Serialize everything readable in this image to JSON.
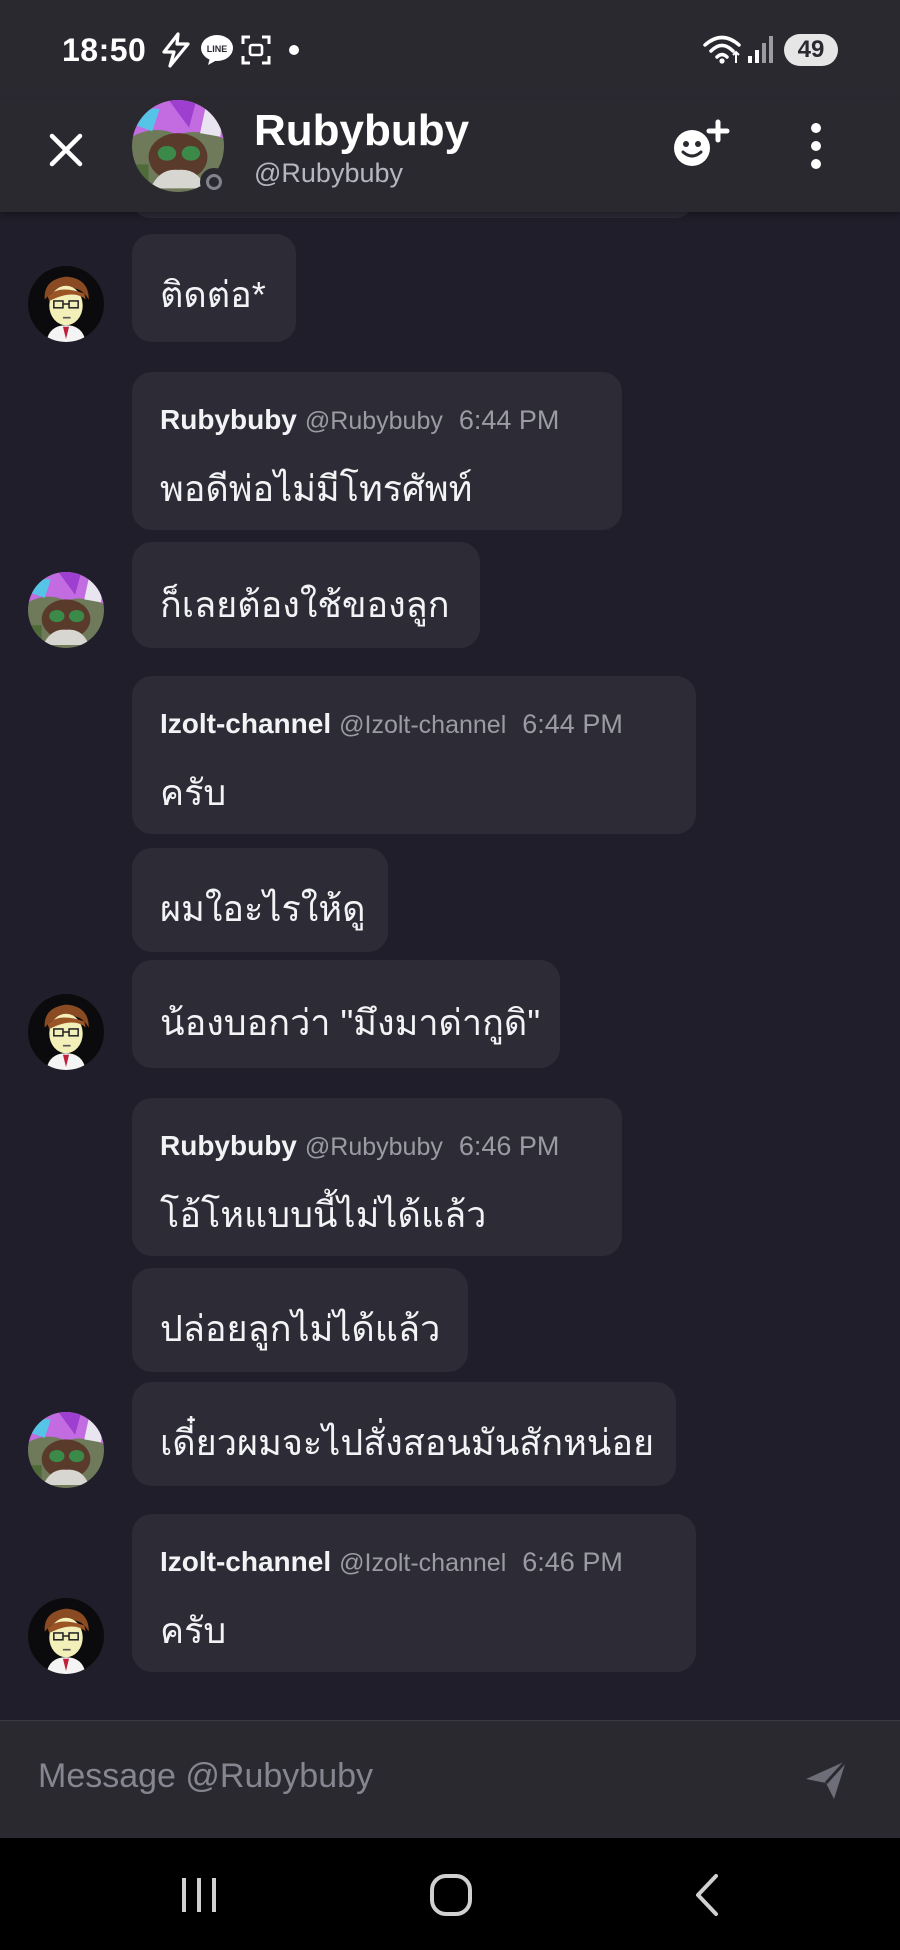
{
  "status_bar": {
    "time": "18:50",
    "battery": "49",
    "icons": [
      "bolt-icon",
      "line-app-icon",
      "screenshot-icon",
      "dot-icon",
      "wifi-icon",
      "signal-icon"
    ]
  },
  "header": {
    "name": "Rubybuby",
    "handle": "@Rubybuby",
    "presence": "offline",
    "icons": [
      "close-icon",
      "add-friend-icon",
      "more-icon"
    ]
  },
  "messages": [
    {
      "text": "ติดต่อ*"
    },
    {
      "author": "Rubybuby",
      "handle": "@Rubybuby",
      "time": "6:44 PM",
      "text": "พอดีพ่อไม่มีโทรศัพท์"
    },
    {
      "text": "ก็เลยต้องใช้ของลูก"
    },
    {
      "author": "Izolt-channel",
      "handle": "@Izolt-channel",
      "time": "6:44 PM",
      "text": "ครับ"
    },
    {
      "text": "ผมใอะไรให้ดู"
    },
    {
      "text": "น้องบอกว่า \"มึงมาด่ากูดิ\""
    },
    {
      "author": "Rubybuby",
      "handle": "@Rubybuby",
      "time": "6:46 PM",
      "text": "โอ้โหแบบนี้ไม่ได้แล้ว"
    },
    {
      "text": "ปล่อยลูกไม่ได้แล้ว"
    },
    {
      "text": "เดี๋ยวผมจะไปสั่งสอนมันสักหน่อย"
    },
    {
      "author": "Izolt-channel",
      "handle": "@Izolt-channel",
      "time": "6:46 PM",
      "text": "ครับ"
    }
  ],
  "composer": {
    "placeholder": "Message @Rubybuby",
    "send_icon": "send-icon"
  },
  "nav_bar": {
    "icons": [
      "recents-icon",
      "home-icon",
      "back-icon"
    ]
  },
  "colors": {
    "background": "#201e2a",
    "header": "#2a2930",
    "bubble": "#2d2c36",
    "text": "#f2f3f5",
    "muted": "#9a9ca4"
  }
}
